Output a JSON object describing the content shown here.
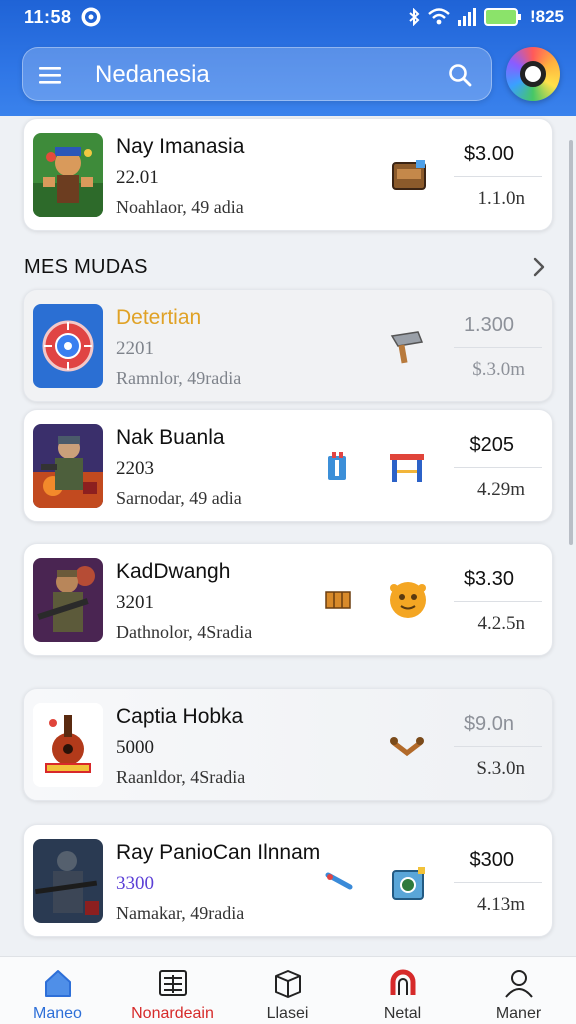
{
  "status_bar": {
    "time": "11:58",
    "battery_text": "!825"
  },
  "search": {
    "value": "Nedanesia"
  },
  "top_item": {
    "title": "Nay Imanasia",
    "count": "22.01",
    "subtitle": "Noahlaor, 49 adia",
    "price": "$3.00",
    "size": "1.1.0n"
  },
  "section": {
    "title": "MES MUDAS"
  },
  "items": [
    {
      "title": "Detertian",
      "count": "2201",
      "subtitle": "Ramnlor, 49radia",
      "price": "1.300",
      "size": "$.3.0m"
    },
    {
      "title": "Nak Buanla",
      "count": "2203",
      "subtitle": "Sarnodar, 49 adia",
      "price": "$205",
      "size": "4.29m"
    },
    {
      "title": "KadDwangh",
      "count": "3201",
      "subtitle": "Dathnolor, 4Sradia",
      "price": "$3.30",
      "size": "4.2.5n"
    },
    {
      "title": "Captia Hobka",
      "count": "5000",
      "subtitle": "Raanldor, 4Sradia",
      "price": "$9.0n",
      "size": "S.3.0n"
    },
    {
      "title": "Ray PanioCan Ilnnam",
      "count": "3300",
      "subtitle": "Namakar, 49radia",
      "price": "$300",
      "size": "4.13m"
    }
  ],
  "nav": [
    {
      "label": "Maneo"
    },
    {
      "label": "Nonardeain"
    },
    {
      "label": "Llasei"
    },
    {
      "label": "Netal"
    },
    {
      "label": "Maner"
    }
  ],
  "colors": {
    "header": "#2f76e6",
    "accent_blue": "#2d6fd8",
    "accent_red": "#d62a2a",
    "gold": "#e0a226",
    "purple": "#5b3fd6"
  },
  "icons": {
    "status": [
      "app-icon",
      "bluetooth-icon",
      "wifi-icon",
      "signal-icon",
      "battery-icon"
    ],
    "search_bar": [
      "menu-icon",
      "search-icon"
    ],
    "nav": [
      "home-icon",
      "news-icon",
      "box-icon",
      "magnet-icon",
      "person-icon"
    ]
  }
}
